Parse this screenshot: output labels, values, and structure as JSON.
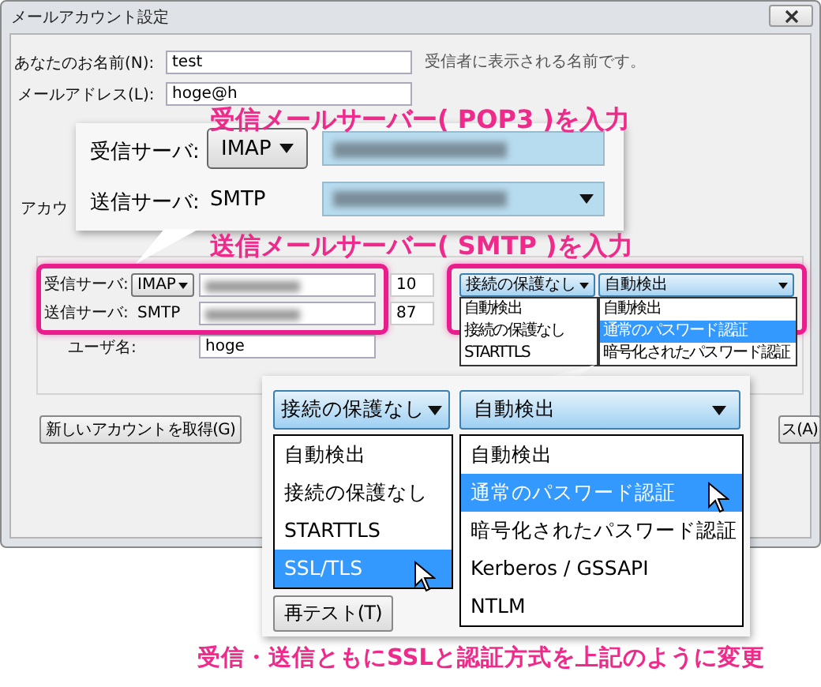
{
  "window": {
    "title": "メールアカウント設定"
  },
  "form": {
    "name": {
      "label": "あなたのお名前(N):",
      "value": "test",
      "hint": "受信者に表示される名前です。"
    },
    "email": {
      "label": "メールアドレス(L):",
      "value": "hoge@h"
    },
    "account_label": "アカウ",
    "incoming": {
      "label": "受信サーバ:",
      "protocol": "IMAP",
      "port": "10",
      "ssl": "接続の保護なし",
      "auth": "自動検出"
    },
    "outgoing": {
      "label": "送信サーバ:",
      "protocol": "SMTP",
      "port": "87"
    },
    "ssl_options": [
      {
        "label": "自動検出",
        "selected": false
      },
      {
        "label": "接続の保護なし",
        "selected": false
      },
      {
        "label": "STARTTLS",
        "selected": false
      }
    ],
    "auth_options": [
      {
        "label": "自動検出",
        "selected": false
      },
      {
        "label": "通常のパスワード認証",
        "selected": true
      },
      {
        "label": "暗号化されたパスワード認証",
        "selected": false
      }
    ],
    "username": {
      "label": "ユーザ名:",
      "value": "hoge"
    },
    "buttons": [
      "新しいアカウントを取得(G)",
      "ス(A)",
      "再テスト(T)"
    ]
  },
  "callout_servers": {
    "heading_incoming": "受信メールサーバー( POP3 )を入力",
    "heading_outgoing": "送信メールサーバー( SMTP )を入力",
    "incoming_label": "受信サーバ:",
    "incoming_protocol": "IMAP",
    "outgoing_label": "送信サーバ:",
    "outgoing_protocol": "SMTP"
  },
  "callout_security": {
    "ssl": "接続の保護なし",
    "auth": "自動検出",
    "ssl_options": [
      {
        "label": "自動検出",
        "selected": false
      },
      {
        "label": "接続の保護なし",
        "selected": false
      },
      {
        "label": "STARTTLS",
        "selected": false
      },
      {
        "label": "SSL/TLS",
        "selected": true
      }
    ],
    "auth_options": [
      {
        "label": "自動検出",
        "selected": false
      },
      {
        "label": "通常のパスワード認証",
        "selected": true
      },
      {
        "label": "暗号化されたパスワード認証",
        "selected": false
      },
      {
        "label": "Kerberos / GSSAPI",
        "selected": false
      },
      {
        "label": "NTLM",
        "selected": false
      }
    ],
    "caption": "受信・送信ともにSSLと認証方式を上記のように変更"
  }
}
